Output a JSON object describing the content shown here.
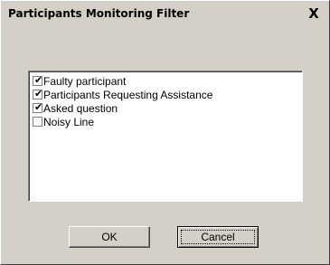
{
  "window": {
    "title": "Participants Monitoring Filter",
    "close_label": "X"
  },
  "filters": {
    "items": [
      {
        "label": "Faulty participant",
        "checked": true
      },
      {
        "label": "Participants Requesting Assistance",
        "checked": true
      },
      {
        "label": "Asked question",
        "checked": true
      },
      {
        "label": "Noisy Line",
        "checked": false
      }
    ]
  },
  "buttons": {
    "ok_label": "OK",
    "cancel_label": "Cancel"
  }
}
